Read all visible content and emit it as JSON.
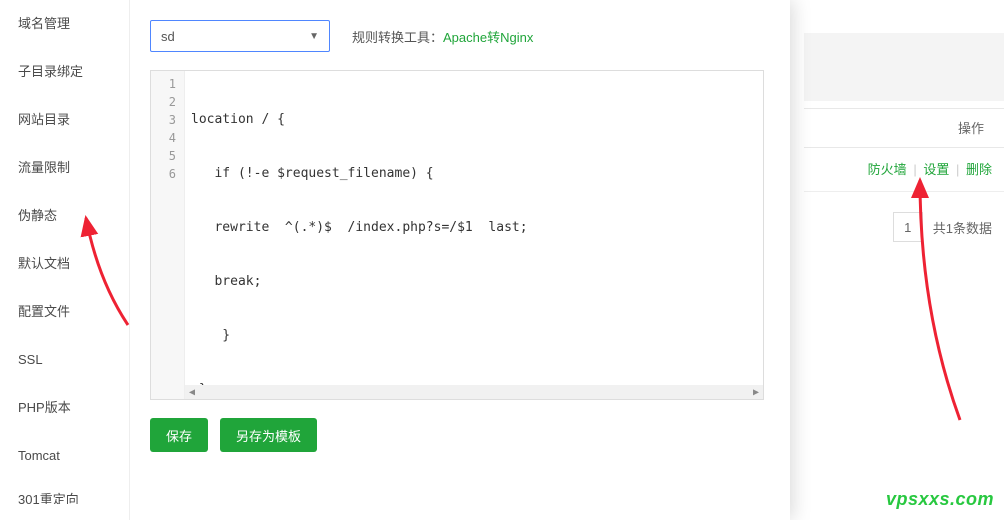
{
  "sidebar": {
    "items": [
      {
        "label": "域名管理"
      },
      {
        "label": "子目录绑定"
      },
      {
        "label": "网站目录"
      },
      {
        "label": "流量限制"
      },
      {
        "label": "伪静态"
      },
      {
        "label": "默认文档"
      },
      {
        "label": "配置文件"
      },
      {
        "label": "SSL"
      },
      {
        "label": "PHP版本"
      },
      {
        "label": "Tomcat"
      },
      {
        "label": "301重定向"
      }
    ]
  },
  "toolbar": {
    "select_value": "sd",
    "tool_label": "规则转换工具：",
    "tool_link": "Apache转Nginx"
  },
  "editor": {
    "lines": [
      "location / {",
      "   if (!-e $request_filename) {",
      "   rewrite  ^(.*)$  /index.php?s=/$1  last;",
      "   break;",
      "    }",
      " }"
    ]
  },
  "actions": {
    "save": "保存",
    "save_as": "另存为模板"
  },
  "bg": {
    "col_header": "操作",
    "link_firewall": "防火墙",
    "link_settings": "设置",
    "link_delete": "删除",
    "page_num": "1",
    "page_text": "共1条数据"
  },
  "watermark": "vpsxxs.com"
}
